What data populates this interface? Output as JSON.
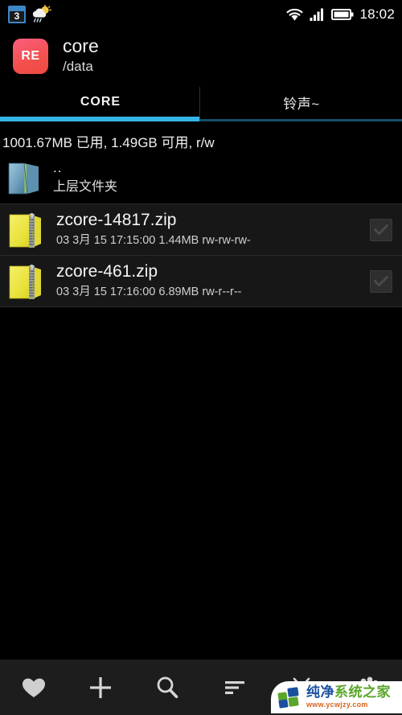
{
  "statusbar": {
    "calendar_day": "3",
    "calendar_icon": "calendar-icon",
    "weather_icon": "weather-sun-cloud-rain-icon",
    "wifi_icon": "wifi-icon",
    "signal_icon": "cellular-signal-icon",
    "battery_icon": "battery-icon",
    "time": "18:02"
  },
  "header": {
    "app_icon_label": "RE",
    "title": "core",
    "subtitle": "/data"
  },
  "tabs": {
    "active_index": 0,
    "accent_color": "#33B5E5",
    "items": [
      {
        "label": "CORE"
      },
      {
        "label": "铃声~"
      }
    ]
  },
  "storage": {
    "info": "1001.67MB 已用, 1.49GB 可用, r/w"
  },
  "files": [
    {
      "icon": "folder-blue-icon",
      "name": "..",
      "meta": "上层文件夹",
      "type": "parent",
      "checkbox": false
    },
    {
      "icon": "folder-zip-icon",
      "name": "zcore-14817.zip",
      "meta": "03 3月 15 17:15:00  1.44MB  rw-rw-rw-",
      "date": "03 3月 15 17:15:00",
      "size": "1.44MB",
      "permissions": "rw-rw-rw-",
      "type": "zip",
      "checkbox": true
    },
    {
      "icon": "folder-zip-icon",
      "name": "zcore-461.zip",
      "meta": "03 3月 15 17:16:00  6.89MB  rw-r--r--",
      "date": "03 3月 15 17:16:00",
      "size": "6.89MB",
      "permissions": "rw-r--r--",
      "type": "zip",
      "checkbox": true
    }
  ],
  "bottombar": {
    "items": [
      {
        "icon": "heart-icon",
        "name": "bookmarks-button"
      },
      {
        "icon": "plus-icon",
        "name": "new-button"
      },
      {
        "icon": "search-icon",
        "name": "search-button"
      },
      {
        "icon": "sort-icon",
        "name": "sort-button"
      },
      {
        "icon": "cut-icon",
        "name": "cut-button"
      },
      {
        "icon": "more-icon",
        "name": "more-button"
      }
    ]
  },
  "watermark": {
    "logo": "four-squares-logo",
    "title_part1": "纯净",
    "title_part2": "系统之家",
    "url": "www.ycwjzy.com"
  }
}
